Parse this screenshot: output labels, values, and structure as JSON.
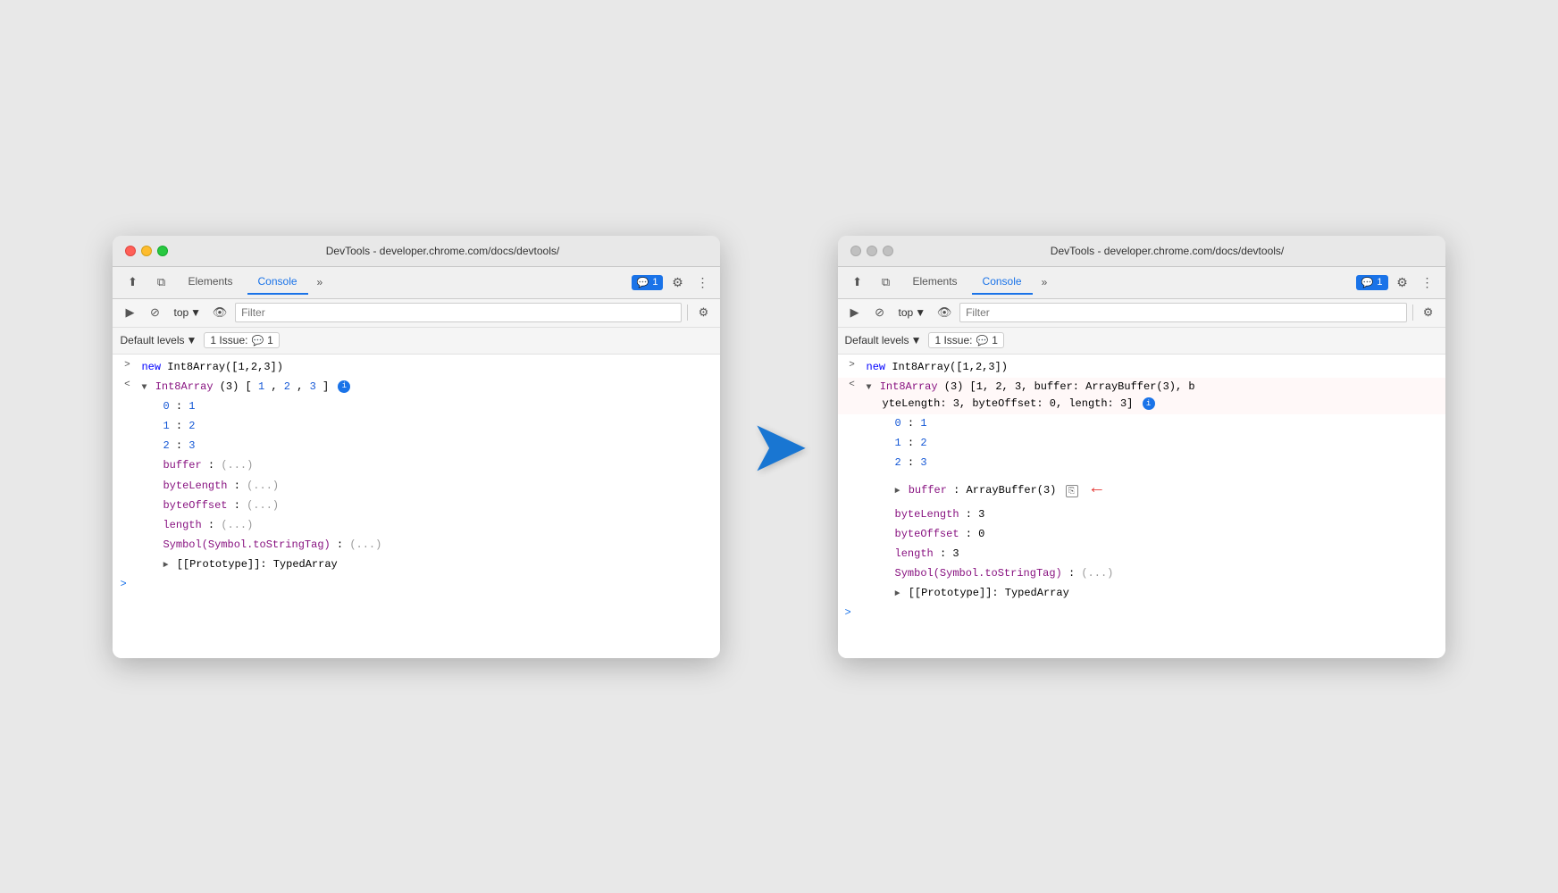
{
  "left_window": {
    "title": "DevTools - developer.chrome.com/docs/devtools/",
    "tabs": [
      "Elements",
      "Console"
    ],
    "active_tab": "Console",
    "badge_label": "1",
    "filter_placeholder": "Filter",
    "top_label": "top",
    "default_levels": "Default levels",
    "issues": "1 Issue:",
    "console_lines": [
      {
        "type": "input",
        "text": "new Int8Array([1,2,3])"
      },
      {
        "type": "output_collapsed",
        "text": "Int8Array(3) [1, 2, 3]"
      },
      {
        "type": "prop",
        "label": "0:",
        "value": "1"
      },
      {
        "type": "prop",
        "label": "1:",
        "value": "2"
      },
      {
        "type": "prop",
        "label": "2:",
        "value": "3"
      },
      {
        "type": "prop_lazy",
        "label": "buffer:",
        "value": "(...)"
      },
      {
        "type": "prop_lazy",
        "label": "byteLength:",
        "value": "(...)"
      },
      {
        "type": "prop_lazy",
        "label": "byteOffset:",
        "value": "(...)"
      },
      {
        "type": "prop_lazy",
        "label": "length:",
        "value": "(...)"
      },
      {
        "type": "prop_lazy",
        "label": "Symbol(Symbol.toStringTag):",
        "value": "(...)"
      },
      {
        "type": "proto",
        "text": "[[Prototype]]: TypedArray"
      }
    ]
  },
  "right_window": {
    "title": "DevTools - developer.chrome.com/docs/devtools/",
    "tabs": [
      "Elements",
      "Console"
    ],
    "active_tab": "Console",
    "badge_label": "1",
    "filter_placeholder": "Filter",
    "top_label": "top",
    "default_levels": "Default levels",
    "issues": "1 Issue:",
    "console_lines": [
      {
        "type": "input",
        "text": "new Int8Array([1,2,3])"
      },
      {
        "type": "output_expanded",
        "text": "Int8Array(3) [1, 2, 3, buffer: ArrayBuffer(3), byteLength: 3, byteOffset: 0, length: 3]"
      },
      {
        "type": "prop",
        "label": "0:",
        "value": "1"
      },
      {
        "type": "prop",
        "label": "1:",
        "value": "2"
      },
      {
        "type": "prop",
        "label": "2:",
        "value": "3"
      },
      {
        "type": "prop_expanded",
        "label": "buffer:",
        "value": "ArrayBuffer(3)"
      },
      {
        "type": "prop_value",
        "label": "byteLength:",
        "value": "3"
      },
      {
        "type": "prop_value",
        "label": "byteOffset:",
        "value": "0"
      },
      {
        "type": "prop_value",
        "label": "length:",
        "value": "3"
      },
      {
        "type": "prop_lazy",
        "label": "Symbol(Symbol.toStringTag):",
        "value": "(...)"
      },
      {
        "type": "proto",
        "text": "[[Prototype]]: TypedArray"
      }
    ]
  },
  "arrow": "→",
  "icons": {
    "cursor": "⬆",
    "copy": "⧉",
    "block": "⊘",
    "eye": "👁",
    "play": "▶",
    "settings": "⚙",
    "more": "⋮",
    "chevron": "▾"
  }
}
